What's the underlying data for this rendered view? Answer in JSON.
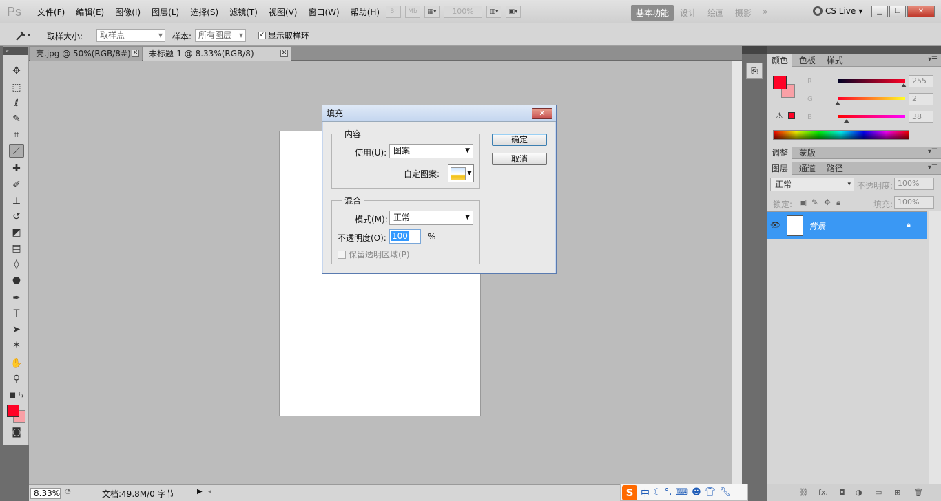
{
  "menubar": {
    "logo": "Ps",
    "items": [
      "文件(F)",
      "编辑(E)",
      "图像(I)",
      "图层(L)",
      "选择(S)",
      "滤镜(T)",
      "视图(V)",
      "窗口(W)",
      "帮助(H)"
    ],
    "bridge": "Br",
    "minibridge": "Mb",
    "zoom": "100%",
    "workspaces": [
      "基本功能",
      "设计",
      "绘画",
      "摄影",
      "»"
    ],
    "cslive": "CS Live"
  },
  "options": {
    "sample_size_label": "取样大小:",
    "sample_size_value": "取样点",
    "sample_label": "样本:",
    "sample_value": "所有图层",
    "show_ring_label": "显示取样环",
    "show_ring_checked": "✓"
  },
  "tabs": [
    {
      "label": "亮.jpg @ 50%(RGB/8#) *"
    },
    {
      "label": "未标题-1 @ 8.33%(RGB/8)"
    }
  ],
  "status": {
    "zoom": "8.33%",
    "doc": "文档:49.8M/0 字节"
  },
  "colors": {
    "foreground": "#ff0226",
    "background": "#f9a0a6"
  },
  "color_panel": {
    "tabs": [
      "颜色",
      "色板",
      "样式"
    ],
    "r_label": "R",
    "g_label": "G",
    "b_label": "B",
    "r_value": "255",
    "g_value": "2",
    "b_value": "38"
  },
  "adjust_panel": {
    "tabs": [
      "调整",
      "蒙版"
    ]
  },
  "layers_panel": {
    "tabs": [
      "图层",
      "通道",
      "路径"
    ],
    "blend_mode": "正常",
    "opacity_label": "不透明度:",
    "opacity_value": "100%",
    "lock_label": "锁定:",
    "fill_label": "填充:",
    "fill_value": "100%",
    "layer_name": "背景",
    "footer_fx": "fx."
  },
  "dialog": {
    "title": "填充",
    "close": "✕",
    "contents_group": "内容",
    "use_label": "使用(U):",
    "use_value": "图案",
    "custom_pattern_label": "自定图案:",
    "blend_group": "混合",
    "mode_label": "模式(M):",
    "mode_value": "正常",
    "opacity_label": "不透明度(O):",
    "opacity_value": "100",
    "opacity_unit": "%",
    "preserve_label": "保留透明区域(P)",
    "ok": "确定",
    "cancel": "取消"
  },
  "ime": {
    "logo": "S",
    "mode": "中"
  }
}
